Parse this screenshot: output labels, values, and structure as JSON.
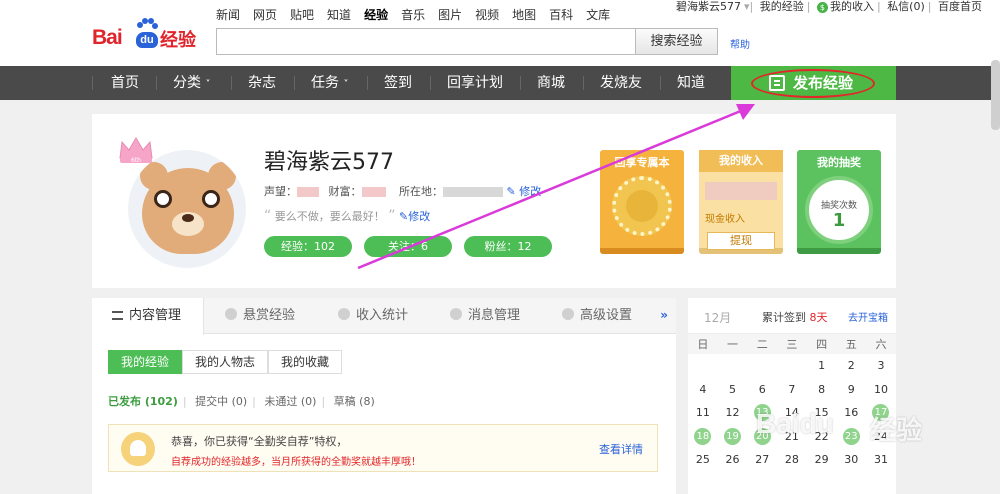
{
  "header": {
    "logo_text": "Bai",
    "logo_du": "du",
    "logo_suffix": "经验",
    "topnav": [
      "新闻",
      "网页",
      "贴吧",
      "知道",
      "经验",
      "音乐",
      "图片",
      "视频",
      "地图",
      "百科",
      "文库"
    ],
    "topnav_active": "经验",
    "user_links": {
      "username": "碧海紫云577",
      "my_exp": "我的经验",
      "my_income": "我的收入",
      "messages": "私信(0)",
      "baidu_home": "百度首页"
    },
    "search_placeholder": "",
    "search_button": "搜索经验",
    "help": "帮助"
  },
  "mainnav": {
    "items": [
      "首页",
      "分类",
      "杂志",
      "任务",
      "签到",
      "回享计划",
      "商城",
      "发烧友",
      "知道"
    ],
    "dropdown_mark": "˅",
    "publish": "发布经验"
  },
  "profile": {
    "name": "碧海紫云577",
    "reputation_label": "声望：",
    "wealth_label": "财富：",
    "location_label": "所在地：",
    "edit": "修改",
    "motto": "要么不做，要么最好！",
    "motto_edit": "修改",
    "crown_badge": "6th",
    "pills": [
      "经验：102",
      "关注：6",
      "粉丝：12"
    ]
  },
  "cards": {
    "card1_title": "回享专属本",
    "card2_title": "我的收入",
    "card2_cash": "现金收入",
    "card2_button": "提现",
    "card3_title": "我的抽奖",
    "card3_label": "抽奖次数",
    "card3_count": "1"
  },
  "content": {
    "tabs": [
      "内容管理",
      "悬赏经验",
      "收入统计",
      "消息管理",
      "高级设置"
    ],
    "more": "»",
    "subtabs": [
      "我的经验",
      "我的人物志",
      "我的收藏"
    ],
    "filters": [
      {
        "label": "已发布 (102)",
        "active": true
      },
      {
        "label": "提交中 (0)",
        "active": false
      },
      {
        "label": "未通过 (0)",
        "active": false
      },
      {
        "label": "草稿 (8)",
        "active": false
      }
    ],
    "notice_line1": "恭喜，你已获得“全勤奖自荐”特权，",
    "notice_line2": "自荐成功的经验越多，当月所获得的全勤奖就越丰厚哦！",
    "notice_link": "查看详情"
  },
  "calendar": {
    "month": "12月",
    "sign_prefix": "累计签到",
    "sign_days": "8天",
    "box": "去开宝箱",
    "weekdays": [
      "日",
      "一",
      "二",
      "三",
      "四",
      "五",
      "六"
    ],
    "rows": [
      [
        "",
        "",
        "",
        "",
        "1",
        "2",
        "3"
      ],
      [
        "4",
        "5",
        "6",
        "7",
        "8",
        "9",
        "10"
      ],
      [
        "11",
        "12",
        "13",
        "14",
        "15",
        "16",
        "17"
      ],
      [
        "18",
        "19",
        "20",
        "21",
        "22",
        "23",
        "24"
      ],
      [
        "25",
        "26",
        "27",
        "28",
        "29",
        "30",
        "31"
      ]
    ],
    "signed": [
      "13",
      "17",
      "18",
      "19",
      "20",
      "23"
    ]
  },
  "watermark": {
    "text": "Bai",
    "text2": "du",
    "cn": "经验"
  },
  "colors": {
    "accent_green": "#4db843",
    "brand_red": "#e1242b",
    "annotation": "#e2262b",
    "arrow": "#d93ad9"
  }
}
